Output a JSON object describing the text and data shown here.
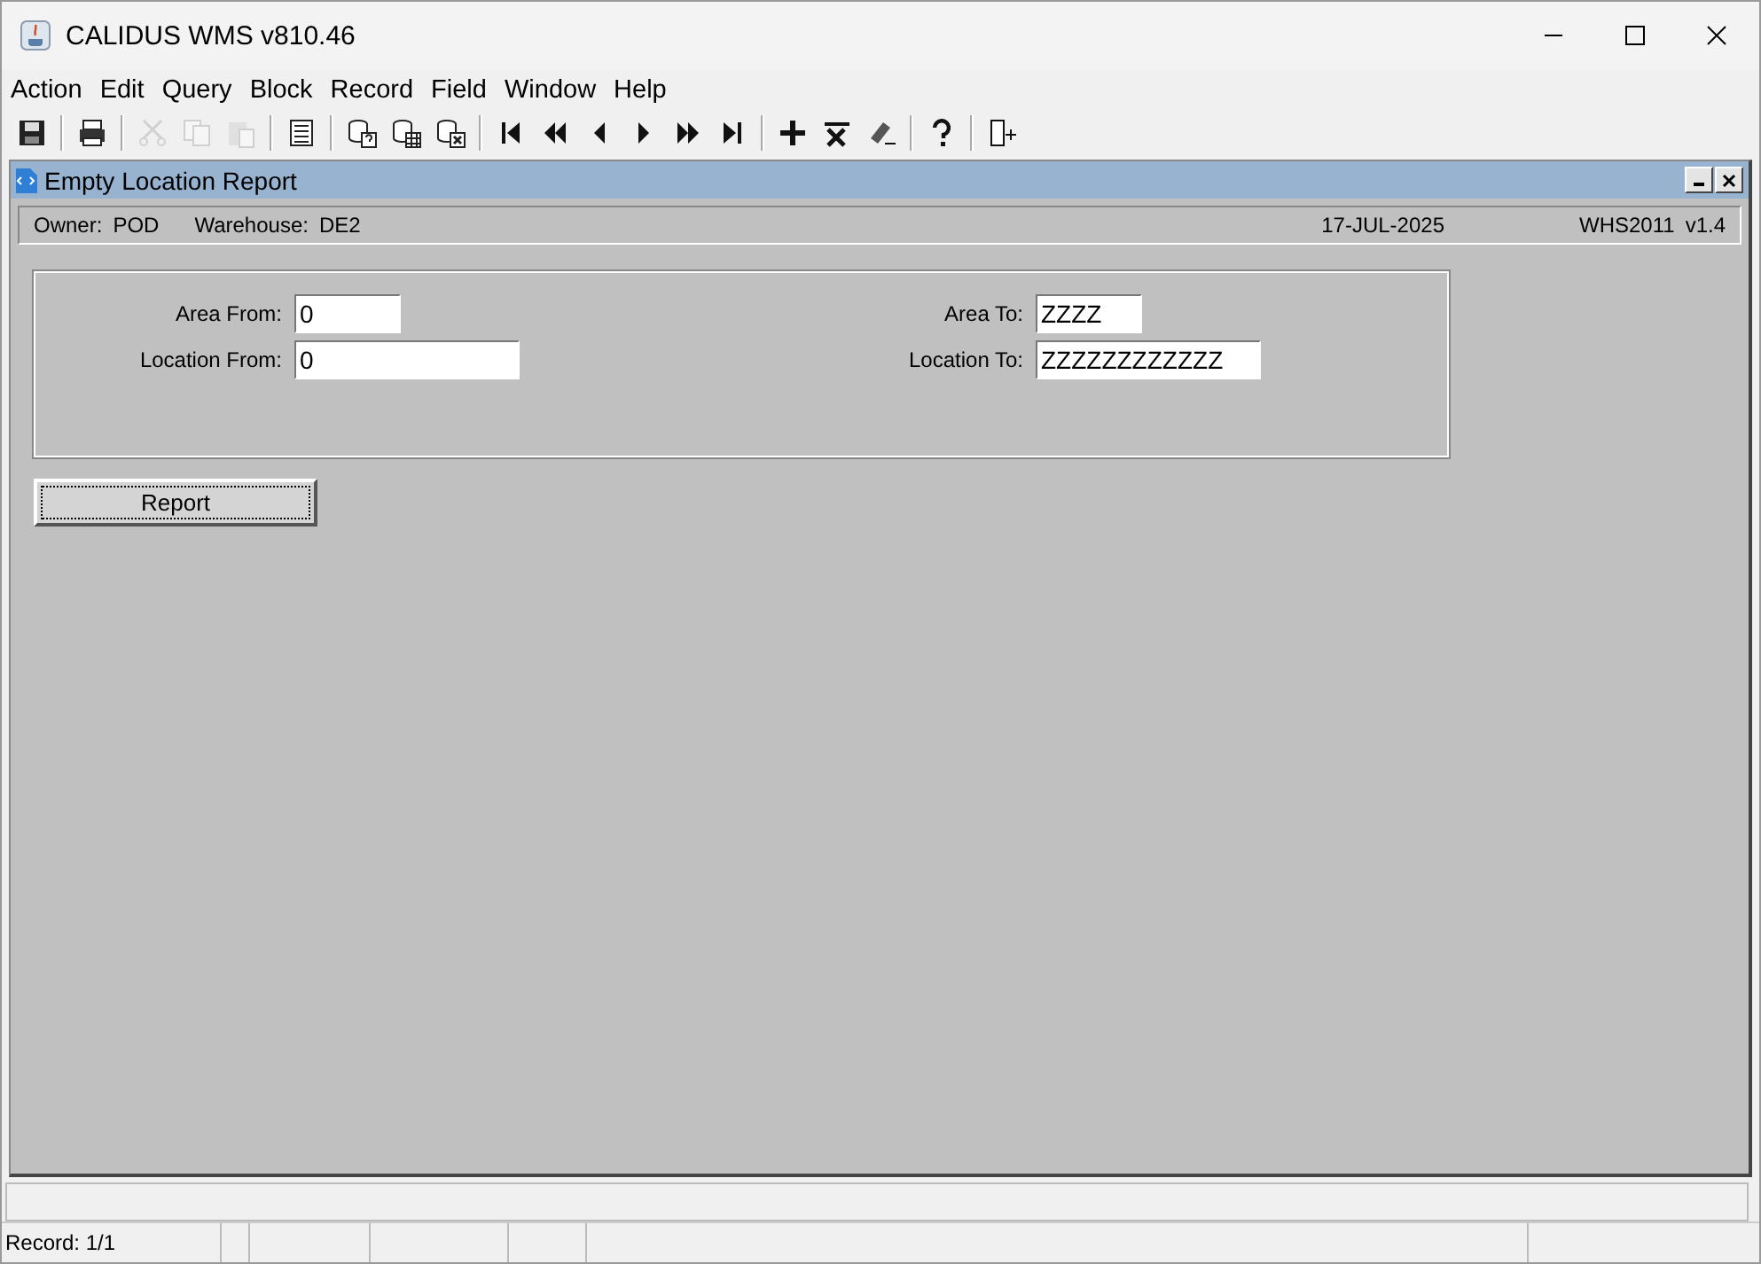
{
  "window": {
    "title": "CALIDUS WMS v810.46"
  },
  "menu": [
    "Action",
    "Edit",
    "Query",
    "Block",
    "Record",
    "Field",
    "Window",
    "Help"
  ],
  "toolbar": [
    [
      {
        "disabled": false
      }
    ],
    [
      {
        "disabled": false
      }
    ],
    [
      {
        "disabled": true
      },
      {
        "disabled": true
      },
      {
        "disabled": true
      }
    ],
    [
      {
        "disabled": false
      }
    ],
    [
      {
        "disabled": false
      },
      {
        "disabled": false
      },
      {
        "disabled": false
      }
    ],
    [
      {
        "disabled": false
      },
      {
        "disabled": false
      },
      {
        "disabled": false
      },
      {
        "disabled": false
      },
      {
        "disabled": false
      },
      {
        "disabled": false
      }
    ],
    [
      {
        "disabled": false
      },
      {
        "disabled": false
      },
      {
        "disabled": false
      }
    ],
    [
      {
        "disabled": false
      }
    ],
    [
      {
        "disabled": false
      }
    ]
  ],
  "form": {
    "title": "Empty Location Report",
    "info": {
      "owner_label": "Owner:",
      "owner": "POD",
      "warehouse_label": "Warehouse:",
      "warehouse": "DE2",
      "date": "17-JUL-2025",
      "module": "WHS2011",
      "version": "v1.4"
    },
    "left_fields": [
      {
        "label": "Area From:",
        "value": "0"
      },
      {
        "label": "Location From:",
        "value": "0"
      }
    ],
    "right_fields": [
      {
        "label": "Area To:",
        "value": "ZZZZ"
      },
      {
        "label": "Location To:",
        "value": "ZZZZZZZZZZZZ"
      }
    ],
    "button": "Report"
  },
  "status_bar": {
    "record": "Record: 1/1"
  }
}
